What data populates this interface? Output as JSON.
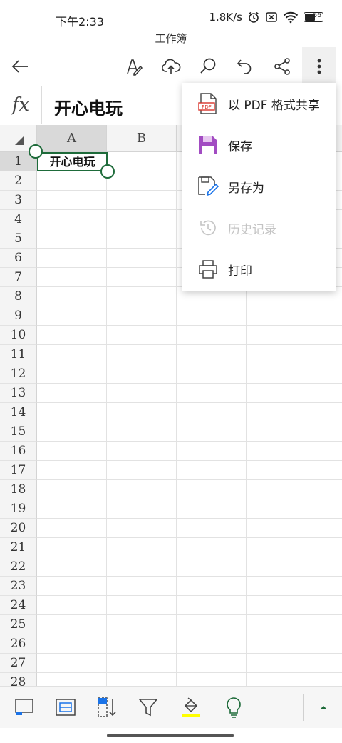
{
  "status": {
    "time": "下午2:33",
    "network_speed": "1.8K/s",
    "battery": "56"
  },
  "document": {
    "name": "工作簿"
  },
  "toolbar": {
    "back_icon": "arrow-left-icon",
    "draw_icon": "pen-icon",
    "upload_icon": "cloud-upload-icon",
    "search_icon": "search-icon",
    "undo_icon": "undo-icon",
    "share_icon": "share-icon",
    "more_icon": "more-vertical-icon"
  },
  "formula_bar": {
    "fx_label": "fx",
    "content": "开心电玩"
  },
  "sheet": {
    "columns": [
      "A",
      "B"
    ],
    "rows": [
      "1",
      "2",
      "3",
      "4",
      "5",
      "6",
      "7",
      "8",
      "9",
      "10",
      "11",
      "12",
      "13",
      "14",
      "15",
      "16",
      "17",
      "18",
      "19",
      "20",
      "21",
      "22",
      "23",
      "24",
      "25",
      "26",
      "27",
      "28"
    ],
    "selected_cell": {
      "column": "A",
      "row": "1",
      "value": "开心电玩"
    }
  },
  "menu": {
    "items": [
      {
        "label": "以 PDF 格式共享",
        "icon": "pdf-icon",
        "enabled": true
      },
      {
        "label": "保存",
        "icon": "save-icon",
        "enabled": true
      },
      {
        "label": "另存为",
        "icon": "save-as-icon",
        "enabled": true
      },
      {
        "label": "历史记录",
        "icon": "history-icon",
        "enabled": false
      },
      {
        "label": "打印",
        "icon": "printer-icon",
        "enabled": true
      }
    ]
  },
  "bottom_toolbar": {
    "icons": [
      "sheet-icon",
      "cell-format-icon",
      "sort-icon",
      "filter-icon",
      "fill-color-icon",
      "lightbulb-icon",
      "expand-up-icon"
    ],
    "fill_color": "#ffff00",
    "accent": "#1e6b3a"
  }
}
